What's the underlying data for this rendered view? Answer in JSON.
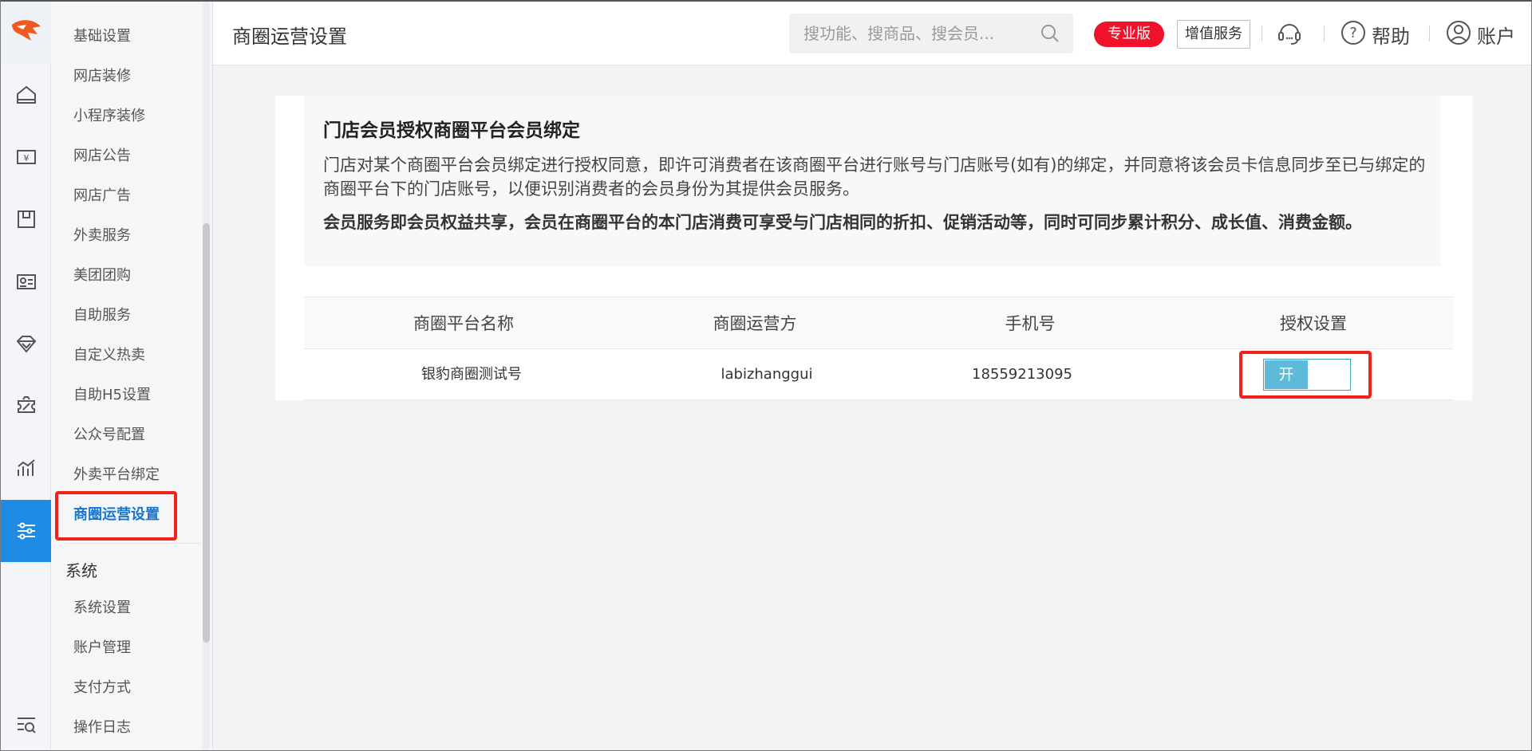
{
  "header": {
    "title": "商圈运营设置",
    "search_placeholder": "搜功能、搜商品、搜会员...",
    "edition_badge": "专业版",
    "value_added_label": "增值服务",
    "help_label": "帮助",
    "account_label": "账户"
  },
  "menu": {
    "items": [
      {
        "label": "基础设置"
      },
      {
        "label": "网店装修"
      },
      {
        "label": "小程序装修"
      },
      {
        "label": "网店公告"
      },
      {
        "label": "网店广告"
      },
      {
        "label": "外卖服务"
      },
      {
        "label": "美团团购"
      },
      {
        "label": "自助服务"
      },
      {
        "label": "自定义热卖"
      },
      {
        "label": "自助H5设置"
      },
      {
        "label": "公众号配置"
      },
      {
        "label": "外卖平台绑定"
      },
      {
        "label": "商圈运营设置"
      }
    ],
    "system_group": "系统",
    "system_items": [
      {
        "label": "系统设置"
      },
      {
        "label": "账户管理"
      },
      {
        "label": "支付方式"
      },
      {
        "label": "操作日志"
      }
    ]
  },
  "rail_icons": [
    "home-icon",
    "cashier-icon",
    "goods-icon",
    "member-card-icon",
    "diamond-icon",
    "coupon-icon",
    "chart-icon",
    "settings-sliders-icon",
    "search-list-icon"
  ],
  "notice": {
    "title": "门店会员授权商圈平台会员绑定",
    "description": "门店对某个商圈平台会员绑定进行授权同意，即许可消费者在该商圈平台进行账号与门店账号(如有)的绑定，并同意将该会员卡信息同步至已与绑定的商圈平台下的门店账号，以便识别消费者的会员身份为其提供会员服务。",
    "bold_text": "会员服务即会员权益共享，会员在商圈平台的本门店消费可享受与门店相同的折扣、促销活动等，同时可同步累计积分、成长值、消费金额。"
  },
  "table": {
    "columns": [
      "商圈平台名称",
      "商圈运营方",
      "手机号",
      "授权设置"
    ],
    "rows": [
      {
        "platform": "银豹商圈测试号",
        "operator": "labizhanggui",
        "phone": "18559213095",
        "toggle_label": "开"
      }
    ]
  },
  "colors": {
    "accent": "#1e8ce4",
    "highlight_box": "#f1221b",
    "badge": "#f0122a",
    "toggle_on": "#5ebad9"
  }
}
